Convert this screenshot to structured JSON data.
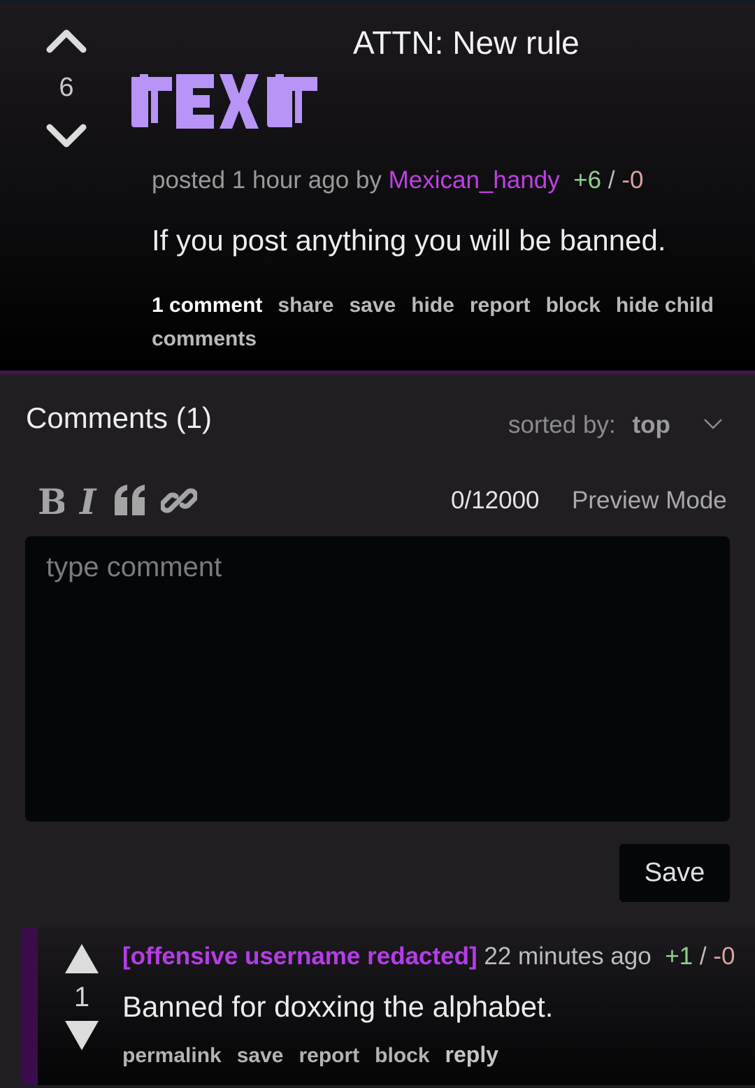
{
  "post": {
    "score": "6",
    "title": "ATTN: New rule",
    "thumbnail_text": "text",
    "meta_prefix": "posted 1 hour ago by",
    "author": "Mexican_handy",
    "upvotes": "+6",
    "separator": "/",
    "downvotes": "-0",
    "body": "If you post anything you will be banned.",
    "actions": [
      "1 comment",
      "share",
      "save",
      "hide",
      "report",
      "block",
      "hide child comments"
    ]
  },
  "comments_section": {
    "title": "Comments (1)",
    "sort_label": "sorted by:",
    "sort_value": "top"
  },
  "editor": {
    "toolbar": [
      {
        "icon": "bold-icon",
        "glyph": "B"
      },
      {
        "icon": "italic-icon",
        "glyph": "I"
      },
      {
        "icon": "quote-icon",
        "glyph": "❝"
      },
      {
        "icon": "link-icon",
        "glyph": "🔗"
      }
    ],
    "counter": "0/12000",
    "preview_label": "Preview Mode",
    "placeholder": "type comment",
    "save_label": "Save"
  },
  "comments": [
    {
      "score": "1",
      "author": "[offensive username redacted]",
      "time": "22 minutes ago",
      "upvotes": "+1",
      "separator": "/",
      "downvotes": "-0",
      "body": "Banned for doxxing the alphabet.",
      "actions": [
        "permalink",
        "save",
        "report",
        "block",
        "reply"
      ]
    }
  ],
  "colors": {
    "accent": "#46134f",
    "author": "#c13fe6",
    "upvote": "#8fd18f",
    "downvote": "#d9a3a3",
    "thumbnail": "#b794f6"
  }
}
